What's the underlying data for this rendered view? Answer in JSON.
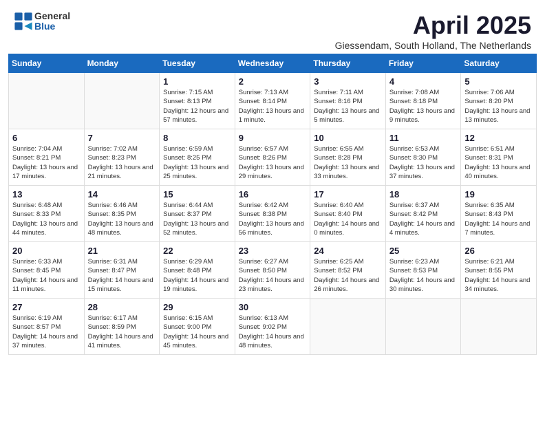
{
  "header": {
    "logo_general": "General",
    "logo_blue": "Blue",
    "month_title": "April 2025",
    "subtitle": "Giessendam, South Holland, The Netherlands"
  },
  "days_of_week": [
    "Sunday",
    "Monday",
    "Tuesday",
    "Wednesday",
    "Thursday",
    "Friday",
    "Saturday"
  ],
  "weeks": [
    [
      {
        "day": "",
        "info": ""
      },
      {
        "day": "",
        "info": ""
      },
      {
        "day": "1",
        "info": "Sunrise: 7:15 AM\nSunset: 8:13 PM\nDaylight: 12 hours\nand 57 minutes."
      },
      {
        "day": "2",
        "info": "Sunrise: 7:13 AM\nSunset: 8:14 PM\nDaylight: 13 hours\nand 1 minute."
      },
      {
        "day": "3",
        "info": "Sunrise: 7:11 AM\nSunset: 8:16 PM\nDaylight: 13 hours\nand 5 minutes."
      },
      {
        "day": "4",
        "info": "Sunrise: 7:08 AM\nSunset: 8:18 PM\nDaylight: 13 hours\nand 9 minutes."
      },
      {
        "day": "5",
        "info": "Sunrise: 7:06 AM\nSunset: 8:20 PM\nDaylight: 13 hours\nand 13 minutes."
      }
    ],
    [
      {
        "day": "6",
        "info": "Sunrise: 7:04 AM\nSunset: 8:21 PM\nDaylight: 13 hours\nand 17 minutes."
      },
      {
        "day": "7",
        "info": "Sunrise: 7:02 AM\nSunset: 8:23 PM\nDaylight: 13 hours\nand 21 minutes."
      },
      {
        "day": "8",
        "info": "Sunrise: 6:59 AM\nSunset: 8:25 PM\nDaylight: 13 hours\nand 25 minutes."
      },
      {
        "day": "9",
        "info": "Sunrise: 6:57 AM\nSunset: 8:26 PM\nDaylight: 13 hours\nand 29 minutes."
      },
      {
        "day": "10",
        "info": "Sunrise: 6:55 AM\nSunset: 8:28 PM\nDaylight: 13 hours\nand 33 minutes."
      },
      {
        "day": "11",
        "info": "Sunrise: 6:53 AM\nSunset: 8:30 PM\nDaylight: 13 hours\nand 37 minutes."
      },
      {
        "day": "12",
        "info": "Sunrise: 6:51 AM\nSunset: 8:31 PM\nDaylight: 13 hours\nand 40 minutes."
      }
    ],
    [
      {
        "day": "13",
        "info": "Sunrise: 6:48 AM\nSunset: 8:33 PM\nDaylight: 13 hours\nand 44 minutes."
      },
      {
        "day": "14",
        "info": "Sunrise: 6:46 AM\nSunset: 8:35 PM\nDaylight: 13 hours\nand 48 minutes."
      },
      {
        "day": "15",
        "info": "Sunrise: 6:44 AM\nSunset: 8:37 PM\nDaylight: 13 hours\nand 52 minutes."
      },
      {
        "day": "16",
        "info": "Sunrise: 6:42 AM\nSunset: 8:38 PM\nDaylight: 13 hours\nand 56 minutes."
      },
      {
        "day": "17",
        "info": "Sunrise: 6:40 AM\nSunset: 8:40 PM\nDaylight: 14 hours\nand 0 minutes."
      },
      {
        "day": "18",
        "info": "Sunrise: 6:37 AM\nSunset: 8:42 PM\nDaylight: 14 hours\nand 4 minutes."
      },
      {
        "day": "19",
        "info": "Sunrise: 6:35 AM\nSunset: 8:43 PM\nDaylight: 14 hours\nand 7 minutes."
      }
    ],
    [
      {
        "day": "20",
        "info": "Sunrise: 6:33 AM\nSunset: 8:45 PM\nDaylight: 14 hours\nand 11 minutes."
      },
      {
        "day": "21",
        "info": "Sunrise: 6:31 AM\nSunset: 8:47 PM\nDaylight: 14 hours\nand 15 minutes."
      },
      {
        "day": "22",
        "info": "Sunrise: 6:29 AM\nSunset: 8:48 PM\nDaylight: 14 hours\nand 19 minutes."
      },
      {
        "day": "23",
        "info": "Sunrise: 6:27 AM\nSunset: 8:50 PM\nDaylight: 14 hours\nand 23 minutes."
      },
      {
        "day": "24",
        "info": "Sunrise: 6:25 AM\nSunset: 8:52 PM\nDaylight: 14 hours\nand 26 minutes."
      },
      {
        "day": "25",
        "info": "Sunrise: 6:23 AM\nSunset: 8:53 PM\nDaylight: 14 hours\nand 30 minutes."
      },
      {
        "day": "26",
        "info": "Sunrise: 6:21 AM\nSunset: 8:55 PM\nDaylight: 14 hours\nand 34 minutes."
      }
    ],
    [
      {
        "day": "27",
        "info": "Sunrise: 6:19 AM\nSunset: 8:57 PM\nDaylight: 14 hours\nand 37 minutes."
      },
      {
        "day": "28",
        "info": "Sunrise: 6:17 AM\nSunset: 8:59 PM\nDaylight: 14 hours\nand 41 minutes."
      },
      {
        "day": "29",
        "info": "Sunrise: 6:15 AM\nSunset: 9:00 PM\nDaylight: 14 hours\nand 45 minutes."
      },
      {
        "day": "30",
        "info": "Sunrise: 6:13 AM\nSunset: 9:02 PM\nDaylight: 14 hours\nand 48 minutes."
      },
      {
        "day": "",
        "info": ""
      },
      {
        "day": "",
        "info": ""
      },
      {
        "day": "",
        "info": ""
      }
    ]
  ]
}
